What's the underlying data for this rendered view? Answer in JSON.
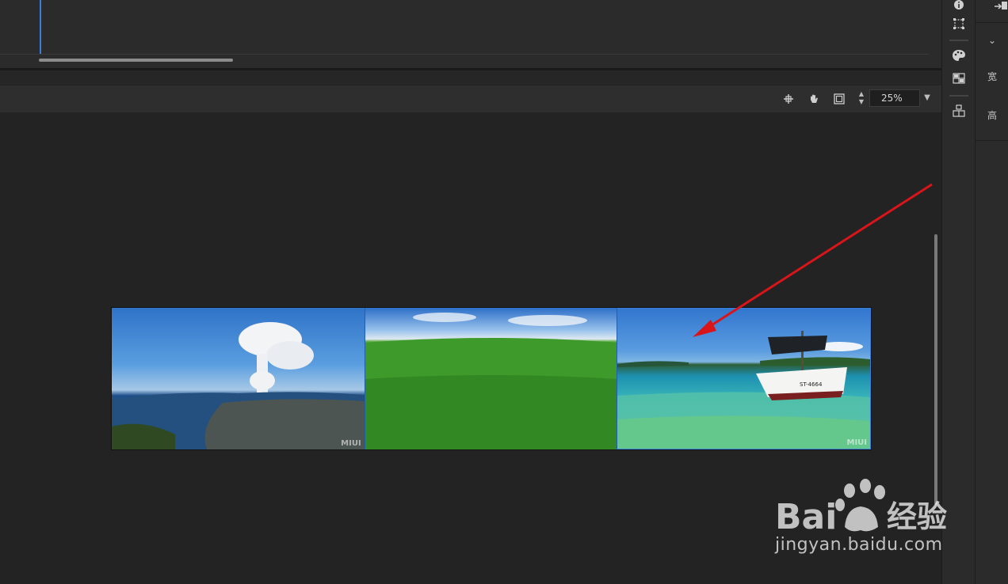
{
  "toolbar": {
    "zoom_value": "25%",
    "tools": [
      "crosshair-icon",
      "hand-icon",
      "frame-icon"
    ]
  },
  "canvas": {
    "photos": [
      {
        "name": "volcano-city",
        "watermark": "MIUI"
      },
      {
        "name": "green-field",
        "watermark": ""
      },
      {
        "name": "boat-sea",
        "watermark": "MIUI",
        "boat_label": "ST-4664"
      }
    ]
  },
  "right_rail": {
    "icons": [
      "info-icon",
      "transform-icon",
      "palette-icon",
      "grid-icon",
      "layers-icon"
    ]
  },
  "panel": {
    "width_label": "宽",
    "height_label": "高"
  },
  "watermark": {
    "brand": "Bai",
    "brand_cn": "经验",
    "url": "jingyan.baidu.com"
  },
  "colors": {
    "accent": "#3d7cd9",
    "arrow": "#d9151a"
  }
}
